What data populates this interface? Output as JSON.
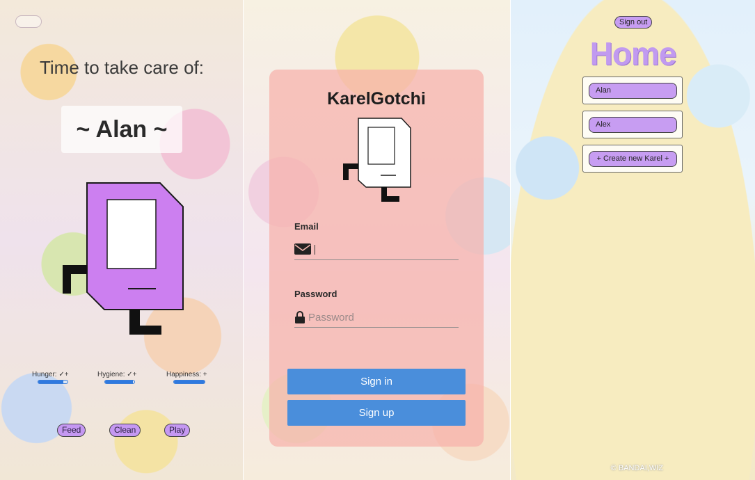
{
  "colors": {
    "accent_purple": "#c598f2",
    "pet_purple": "#cc7ff0",
    "primary_blue": "#4a8edb",
    "card_salmon": "#f7b2aa",
    "home_title": "#c19af0"
  },
  "pet_screen": {
    "title": "Time to take care of:",
    "pet_name": "~ Alan ~",
    "stats": [
      {
        "label": "Hunger: ✓+",
        "level": 0.85
      },
      {
        "label": "Hygiene: ✓+",
        "level": 0.95
      },
      {
        "label": "Happiness: +",
        "level": 1.0
      }
    ],
    "actions": {
      "feed": "Feed",
      "clean": "Clean",
      "play": "Play"
    }
  },
  "login_screen": {
    "app_title": "KarelGotchi",
    "email_label": "Email",
    "email_value": "",
    "password_label": "Password",
    "password_placeholder": "Password",
    "sign_in": "Sign in",
    "sign_up": "Sign up"
  },
  "home_screen": {
    "sign_out": "Sign out",
    "title": "Home",
    "karels": [
      "Alan",
      "Alex"
    ],
    "create_new": "+ Create new Karel +",
    "copyright": "© BANDAI,WIZ"
  }
}
